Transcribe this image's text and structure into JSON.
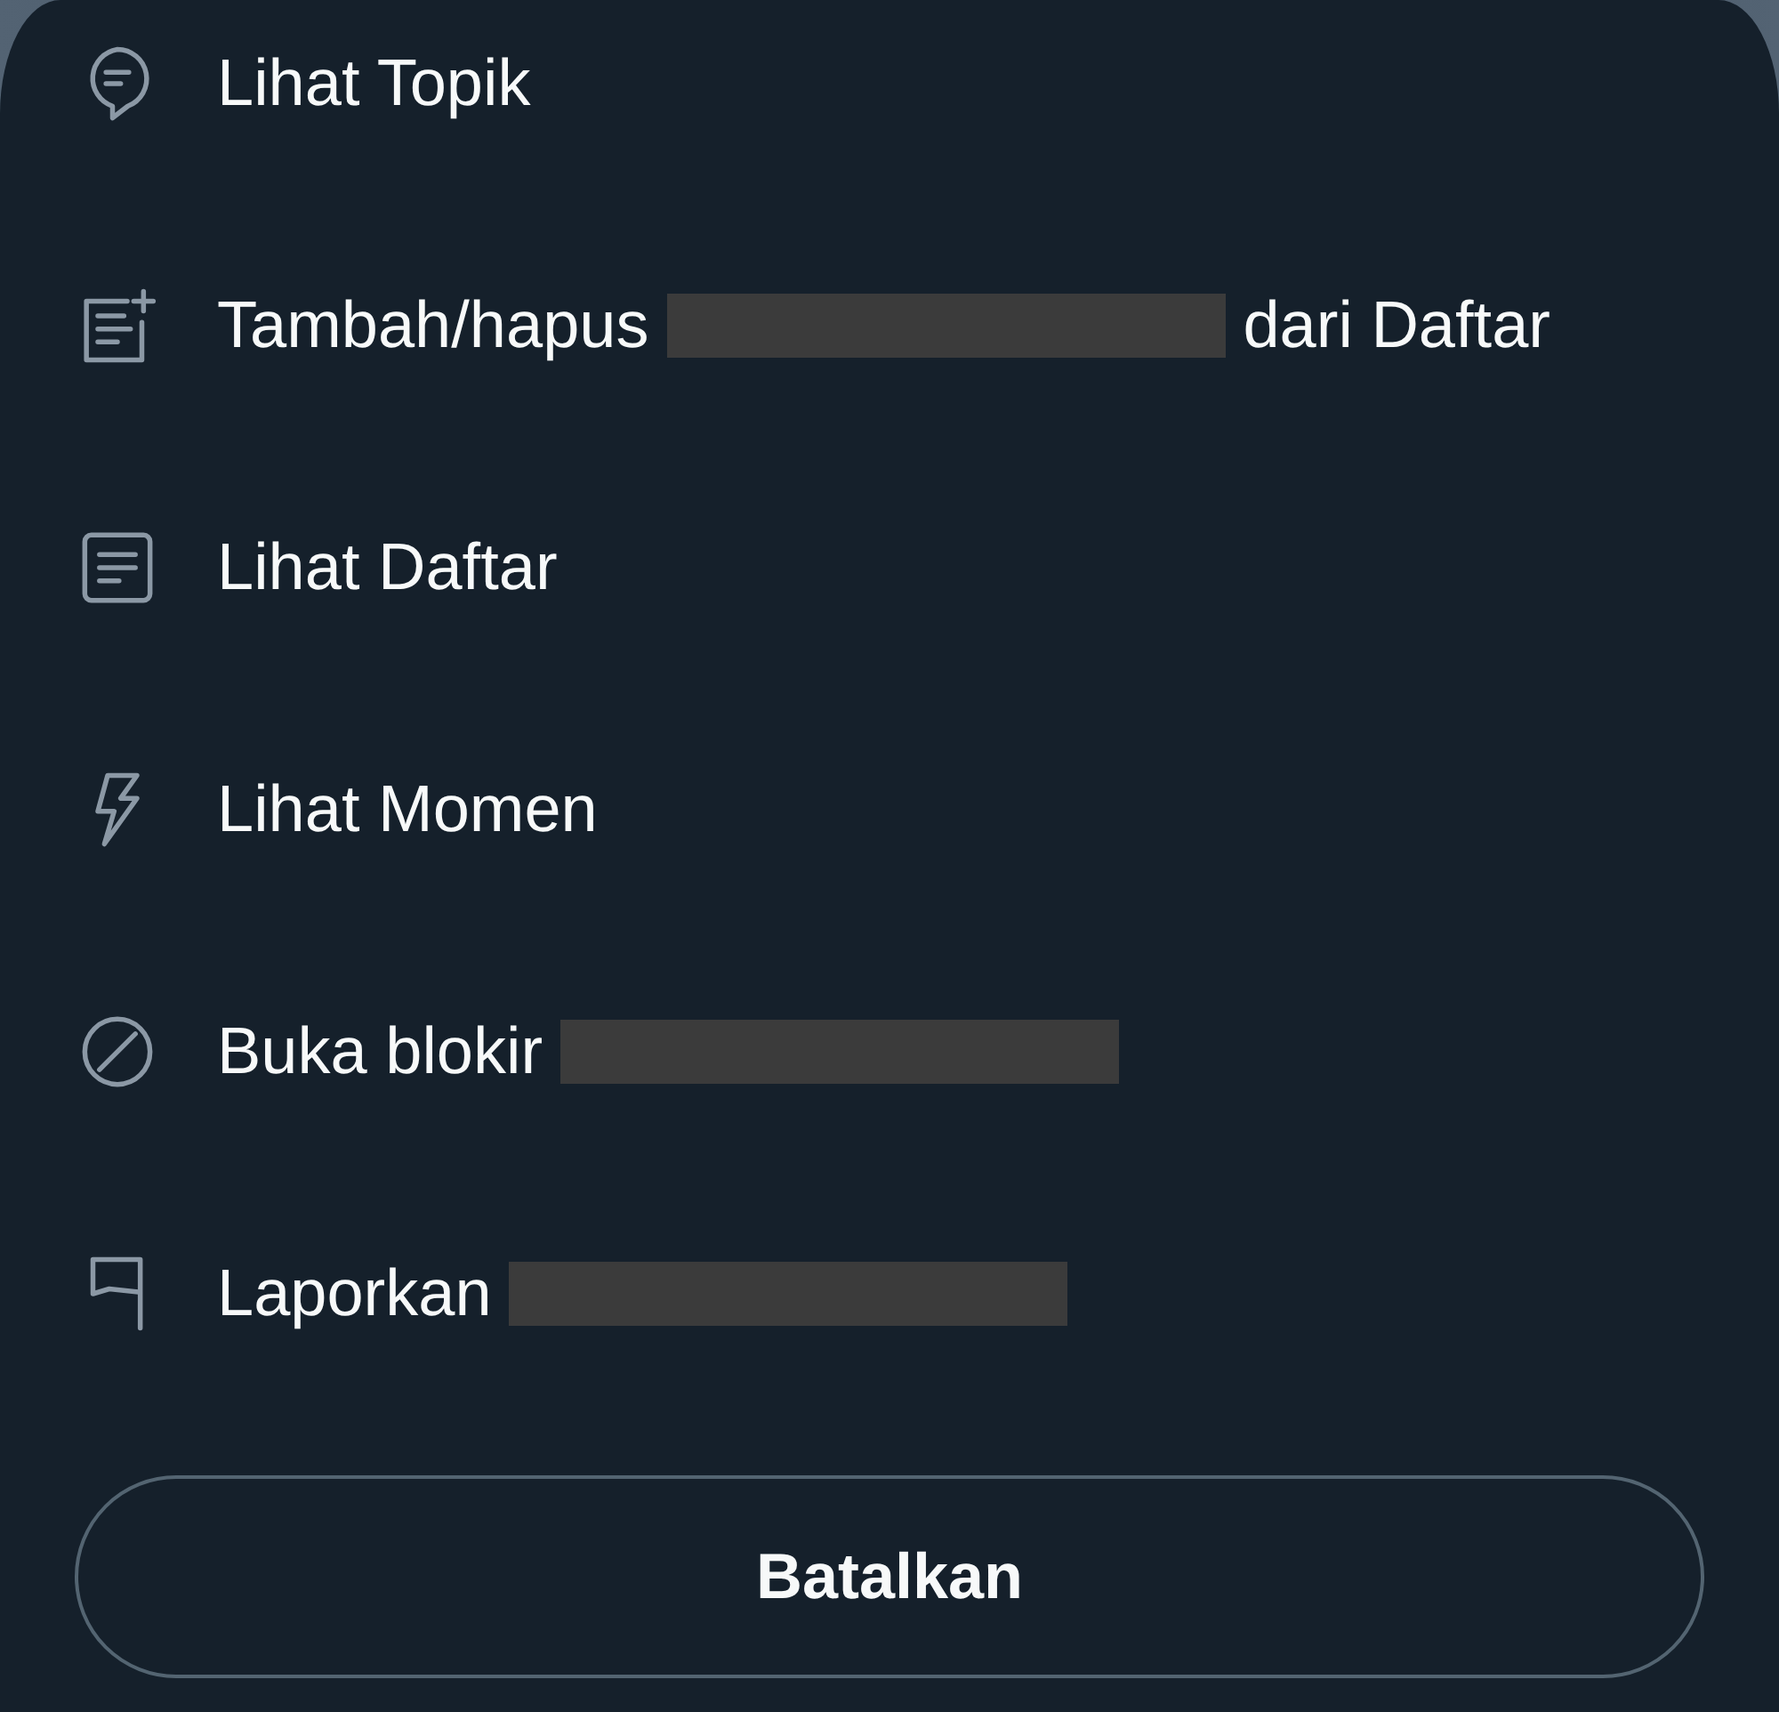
{
  "menu": {
    "items": [
      {
        "kind": "topics",
        "parts": [
          {
            "kind": "text",
            "text": "Lihat Topik"
          }
        ]
      },
      {
        "kind": "list-add",
        "parts": [
          {
            "kind": "text",
            "text": "Tambah/hapus"
          },
          {
            "kind": "redacted"
          },
          {
            "kind": "text",
            "text": "dari Daftar"
          }
        ]
      },
      {
        "kind": "list",
        "parts": [
          {
            "kind": "text",
            "text": "Lihat Daftar"
          }
        ]
      },
      {
        "kind": "moments",
        "parts": [
          {
            "kind": "text",
            "text": "Lihat Momen"
          }
        ]
      },
      {
        "kind": "unblock",
        "parts": [
          {
            "kind": "text",
            "text": "Buka blokir"
          },
          {
            "kind": "redacted"
          }
        ]
      },
      {
        "kind": "report",
        "parts": [
          {
            "kind": "text",
            "text": "Laporkan"
          },
          {
            "kind": "redacted"
          }
        ]
      }
    ]
  },
  "cancel_button": {
    "label": "Batalkan"
  }
}
